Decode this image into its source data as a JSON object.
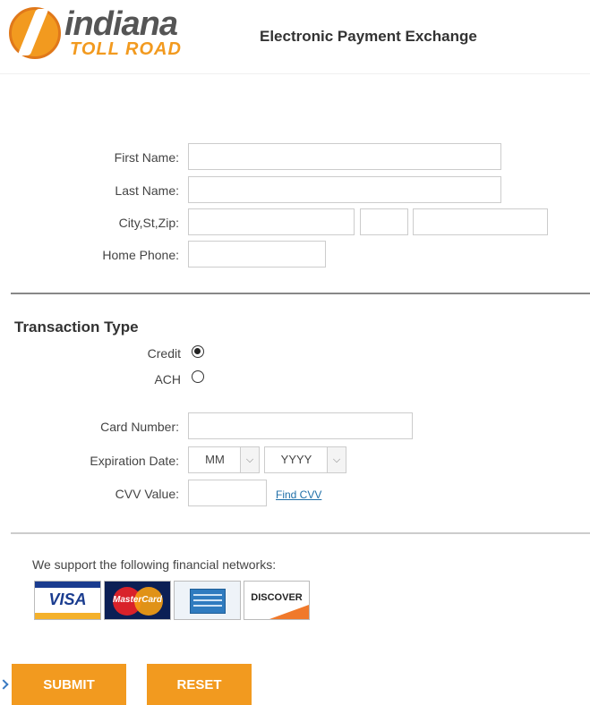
{
  "header": {
    "logo_word1": "indiana",
    "logo_word2": "TOLL ROAD",
    "title": "Electronic Payment Exchange"
  },
  "customer": {
    "first_name_label": "First Name:",
    "last_name_label": "Last Name:",
    "city_label": "City,St,Zip:",
    "phone_label": "Home Phone:",
    "first_name_value": "",
    "last_name_value": "",
    "city_value": "",
    "state_value": "",
    "zip_value": "",
    "phone_value": ""
  },
  "transaction": {
    "title": "Transaction Type",
    "credit_label": "Credit",
    "ach_label": "ACH",
    "selected": "credit"
  },
  "card": {
    "number_label": "Card Number:",
    "exp_label": "Expiration Date:",
    "cvv_label": "CVV Value:",
    "month_value": "MM",
    "year_value": "YYYY",
    "find_cvv": "Find CVV"
  },
  "networks": {
    "text": "We support the following financial networks:",
    "visa": "VISA",
    "mastercard": "MasterCard",
    "discover": "DISCOVER"
  },
  "buttons": {
    "submit": "SUBMIT",
    "reset": "RESET"
  },
  "colors": {
    "accent": "#f29a1f",
    "link": "#1f6fa8"
  }
}
